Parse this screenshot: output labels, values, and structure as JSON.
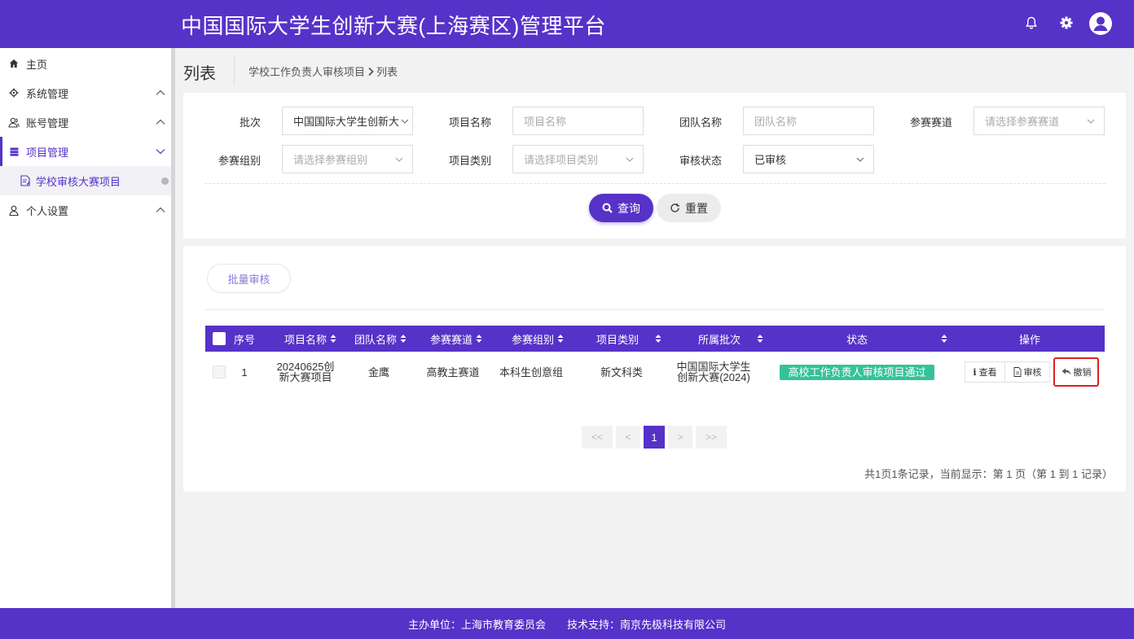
{
  "header": {
    "title": "中国国际大学生创新大赛(上海赛区)管理平台"
  },
  "sidebar": {
    "items": [
      {
        "label": "主页"
      },
      {
        "label": "系统管理"
      },
      {
        "label": "账号管理"
      },
      {
        "label": "项目管理"
      },
      {
        "label": "学校审核大赛项目"
      },
      {
        "label": "个人设置"
      }
    ]
  },
  "page": {
    "title": "列表",
    "breadcrumb": [
      "学校工作负责人审核项目",
      "列表"
    ]
  },
  "filters": {
    "batch": {
      "label": "批次",
      "value": "中国国际大学生创新大"
    },
    "project_name": {
      "label": "项目名称",
      "placeholder": "项目名称"
    },
    "team_name": {
      "label": "团队名称",
      "placeholder": "团队名称"
    },
    "track": {
      "label": "参赛赛道",
      "placeholder": "请选择参赛赛道"
    },
    "group": {
      "label": "参赛组别",
      "placeholder": "请选择参赛组别"
    },
    "category": {
      "label": "项目类别",
      "placeholder": "请选择项目类别"
    },
    "review_status": {
      "label": "审核状态",
      "value": "已审核"
    },
    "query_label": "查询",
    "reset_label": "重置"
  },
  "list": {
    "batch_review_label": "批量审核",
    "columns": [
      "序号",
      "项目名称",
      "团队名称",
      "参赛赛道",
      "参赛组别",
      "项目类别",
      "所属批次",
      "状态",
      "操作"
    ],
    "rows": [
      {
        "index": "1",
        "project_name": "20240625创新大赛项目",
        "team_name": "金鹰",
        "track": "高教主赛道",
        "group": "本科生创意组",
        "category": "新文科类",
        "batch": "中国国际大学生创新大赛(2024)",
        "status": "高校工作负责人审核项目通过",
        "actions": {
          "view": "查看",
          "review": "审核",
          "revoke": "撤销"
        }
      }
    ],
    "pagination": {
      "first": "<<",
      "prev": "<",
      "current": "1",
      "next": ">",
      "last": ">>",
      "summary": "共1页1条记录，当前显示：第 1 页（第 1 到 1 记录）"
    }
  },
  "footer": {
    "organizer": "主办单位：上海市教育委员会",
    "support": "技术支持：南京先极科技有限公司"
  },
  "colors": {
    "primary": "#5632c8",
    "status_green": "#37c19a",
    "highlight_red": "#e02020"
  }
}
